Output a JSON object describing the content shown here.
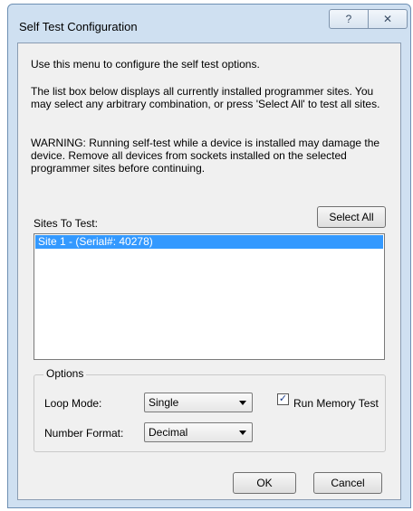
{
  "window": {
    "title": "Self Test Configuration"
  },
  "titlebar": {
    "help_glyph": "?",
    "close_glyph": "✕"
  },
  "text": {
    "intro": "Use this menu to configure the self test options.",
    "listinfo": "The list box below displays all currently installed programmer sites.  You may select any arbitrary combination, or press 'Select All' to test all sites.",
    "warning": "WARNING: Running self-test while a device is installed may damage the device.  Remove all devices from sockets installed on the selected programmer sites before continuing."
  },
  "sites": {
    "label": "Sites To Test:",
    "select_all_label": "Select All",
    "items": [
      "Site 1 - (Serial#: 40278)"
    ],
    "selected_index": 0
  },
  "options": {
    "title": "Options",
    "loop_mode_label": "Loop Mode:",
    "loop_mode_value": "Single",
    "number_format_label": "Number Format:",
    "number_format_value": "Decimal",
    "run_memory_test_label": "Run Memory Test",
    "run_memory_test_checked": true
  },
  "footer": {
    "ok_label": "OK",
    "cancel_label": "Cancel"
  },
  "colors": {
    "selection": "#3399ff",
    "dialog_bg": "#f0f0f0",
    "frame": "#cfe0f1"
  }
}
